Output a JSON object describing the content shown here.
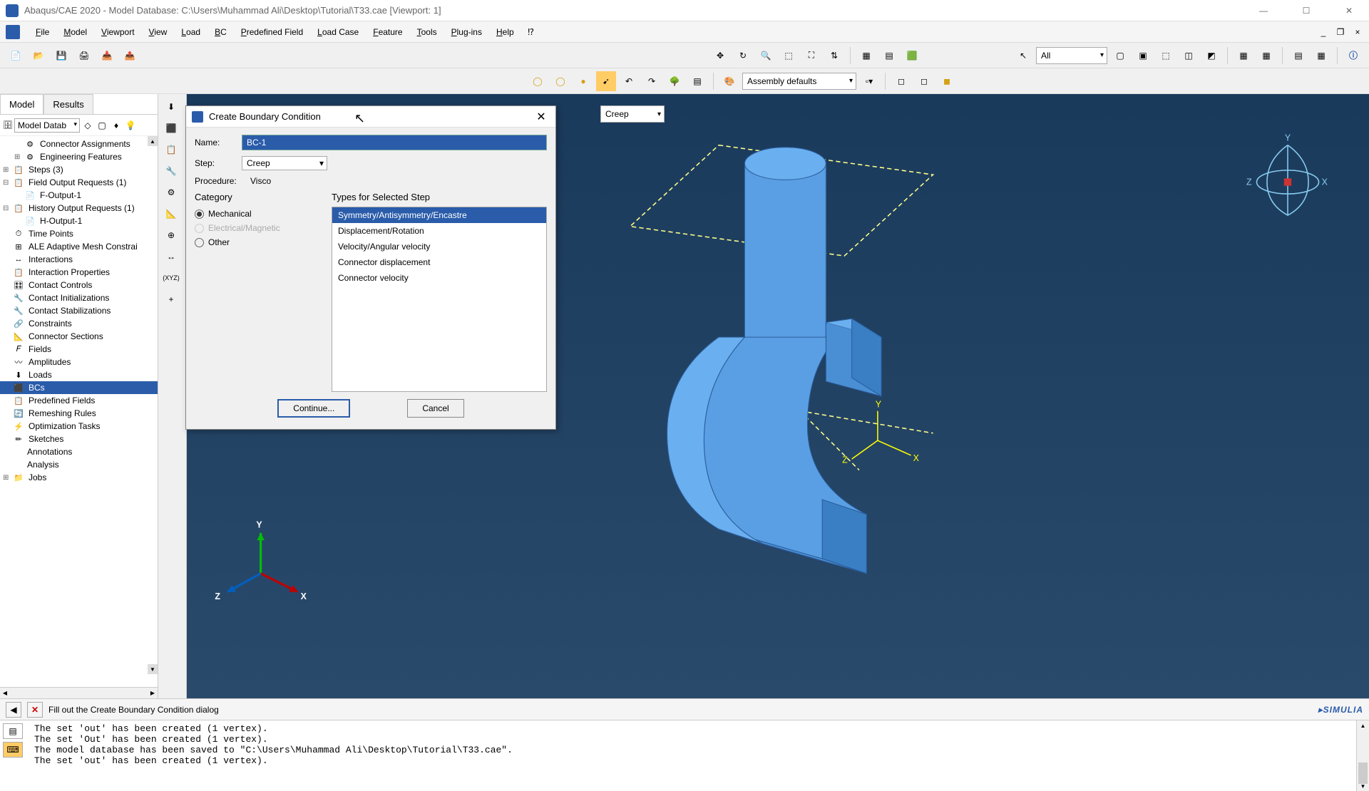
{
  "titlebar": {
    "text": "Abaqus/CAE 2020 - Model Database: C:\\Users\\Muhammad Ali\\Desktop\\Tutorial\\T33.cae [Viewport: 1]"
  },
  "menu": {
    "items": [
      "File",
      "Model",
      "Viewport",
      "View",
      "Load",
      "BC",
      "Predefined Field",
      "Load Case",
      "Feature",
      "Tools",
      "Plug-ins",
      "Help"
    ]
  },
  "toolbar2": {
    "filter": "All",
    "assembly": "Assembly defaults"
  },
  "step_dropdown": "Creep",
  "left_panel": {
    "tabs": [
      "Model",
      "Results"
    ],
    "dd": "Model Datab",
    "tree": [
      {
        "indent": 1,
        "toggle": "",
        "icon": "⚙",
        "label": "Connector Assignments"
      },
      {
        "indent": 1,
        "toggle": "⊞",
        "icon": "⚙",
        "label": "Engineering Features"
      },
      {
        "indent": 0,
        "toggle": "⊞",
        "icon": "📋",
        "label": "Steps (3)"
      },
      {
        "indent": 0,
        "toggle": "⊟",
        "icon": "📋",
        "label": "Field Output Requests (1)"
      },
      {
        "indent": 1,
        "toggle": "",
        "icon": "📄",
        "label": "F-Output-1"
      },
      {
        "indent": 0,
        "toggle": "⊟",
        "icon": "📋",
        "label": "History Output Requests (1)"
      },
      {
        "indent": 1,
        "toggle": "",
        "icon": "📄",
        "label": "H-Output-1"
      },
      {
        "indent": 0,
        "toggle": "",
        "icon": "⏱",
        "label": "Time Points"
      },
      {
        "indent": 0,
        "toggle": "",
        "icon": "⊞",
        "label": "ALE Adaptive Mesh Constrai"
      },
      {
        "indent": 0,
        "toggle": "",
        "icon": "↔",
        "label": "Interactions"
      },
      {
        "indent": 0,
        "toggle": "",
        "icon": "📋",
        "label": "Interaction Properties"
      },
      {
        "indent": 0,
        "toggle": "",
        "icon": "🎛",
        "label": "Contact Controls"
      },
      {
        "indent": 0,
        "toggle": "",
        "icon": "🔧",
        "label": "Contact Initializations"
      },
      {
        "indent": 0,
        "toggle": "",
        "icon": "🔧",
        "label": "Contact Stabilizations"
      },
      {
        "indent": 0,
        "toggle": "",
        "icon": "🔗",
        "label": "Constraints"
      },
      {
        "indent": 0,
        "toggle": "",
        "icon": "📐",
        "label": "Connector Sections"
      },
      {
        "indent": 0,
        "toggle": "",
        "icon": "𝐹",
        "label": "Fields"
      },
      {
        "indent": 0,
        "toggle": "",
        "icon": "〰",
        "label": "Amplitudes"
      },
      {
        "indent": 0,
        "toggle": "",
        "icon": "⬇",
        "label": "Loads"
      },
      {
        "indent": 0,
        "toggle": "",
        "icon": "⬛",
        "label": "BCs",
        "selected": true
      },
      {
        "indent": 0,
        "toggle": "",
        "icon": "📋",
        "label": "Predefined Fields"
      },
      {
        "indent": 0,
        "toggle": "",
        "icon": "🔄",
        "label": "Remeshing Rules"
      },
      {
        "indent": 0,
        "toggle": "",
        "icon": "⚡",
        "label": "Optimization Tasks"
      },
      {
        "indent": 0,
        "toggle": "",
        "icon": "✏",
        "label": "Sketches"
      },
      {
        "indent": -1,
        "toggle": "",
        "icon": "",
        "label": "Annotations"
      },
      {
        "indent": -1,
        "toggle": "",
        "icon": "",
        "label": "Analysis"
      },
      {
        "indent": 0,
        "toggle": "⊞",
        "icon": "📁",
        "label": "Jobs"
      }
    ]
  },
  "dialog": {
    "title": "Create Boundary Condition",
    "name_label": "Name:",
    "name_value": "BC-1",
    "step_label": "Step:",
    "step_value": "Creep",
    "procedure_label": "Procedure:",
    "procedure_value": "Visco",
    "category_label": "Category",
    "categories": [
      {
        "label": "Mechanical",
        "checked": true,
        "disabled": false
      },
      {
        "label": "Electrical/Magnetic",
        "checked": false,
        "disabled": true
      },
      {
        "label": "Other",
        "checked": false,
        "disabled": false
      }
    ],
    "types_label": "Types for Selected Step",
    "types": [
      {
        "label": "Symmetry/Antisymmetry/Encastre",
        "selected": true
      },
      {
        "label": "Displacement/Rotation",
        "selected": false
      },
      {
        "label": "Velocity/Angular velocity",
        "selected": false
      },
      {
        "label": "Connector displacement",
        "selected": false
      },
      {
        "label": "Connector velocity",
        "selected": false
      }
    ],
    "continue": "Continue...",
    "cancel": "Cancel"
  },
  "prompt": {
    "text": "Fill out the Create Boundary Condition dialog",
    "brand": "SIMULIA"
  },
  "messages": {
    "text": "The set 'out' has been created (1 vertex).\nThe set 'Out' has been created (1 vertex).\nThe model database has been saved to \"C:\\Users\\Muhammad Ali\\Desktop\\Tutorial\\T33.cae\".\nThe set 'out' has been created (1 vertex)."
  },
  "coord": {
    "x": "X",
    "y": "Y",
    "z": "Z"
  },
  "triad": {
    "x": "X",
    "y": "Y",
    "z": "Z"
  }
}
